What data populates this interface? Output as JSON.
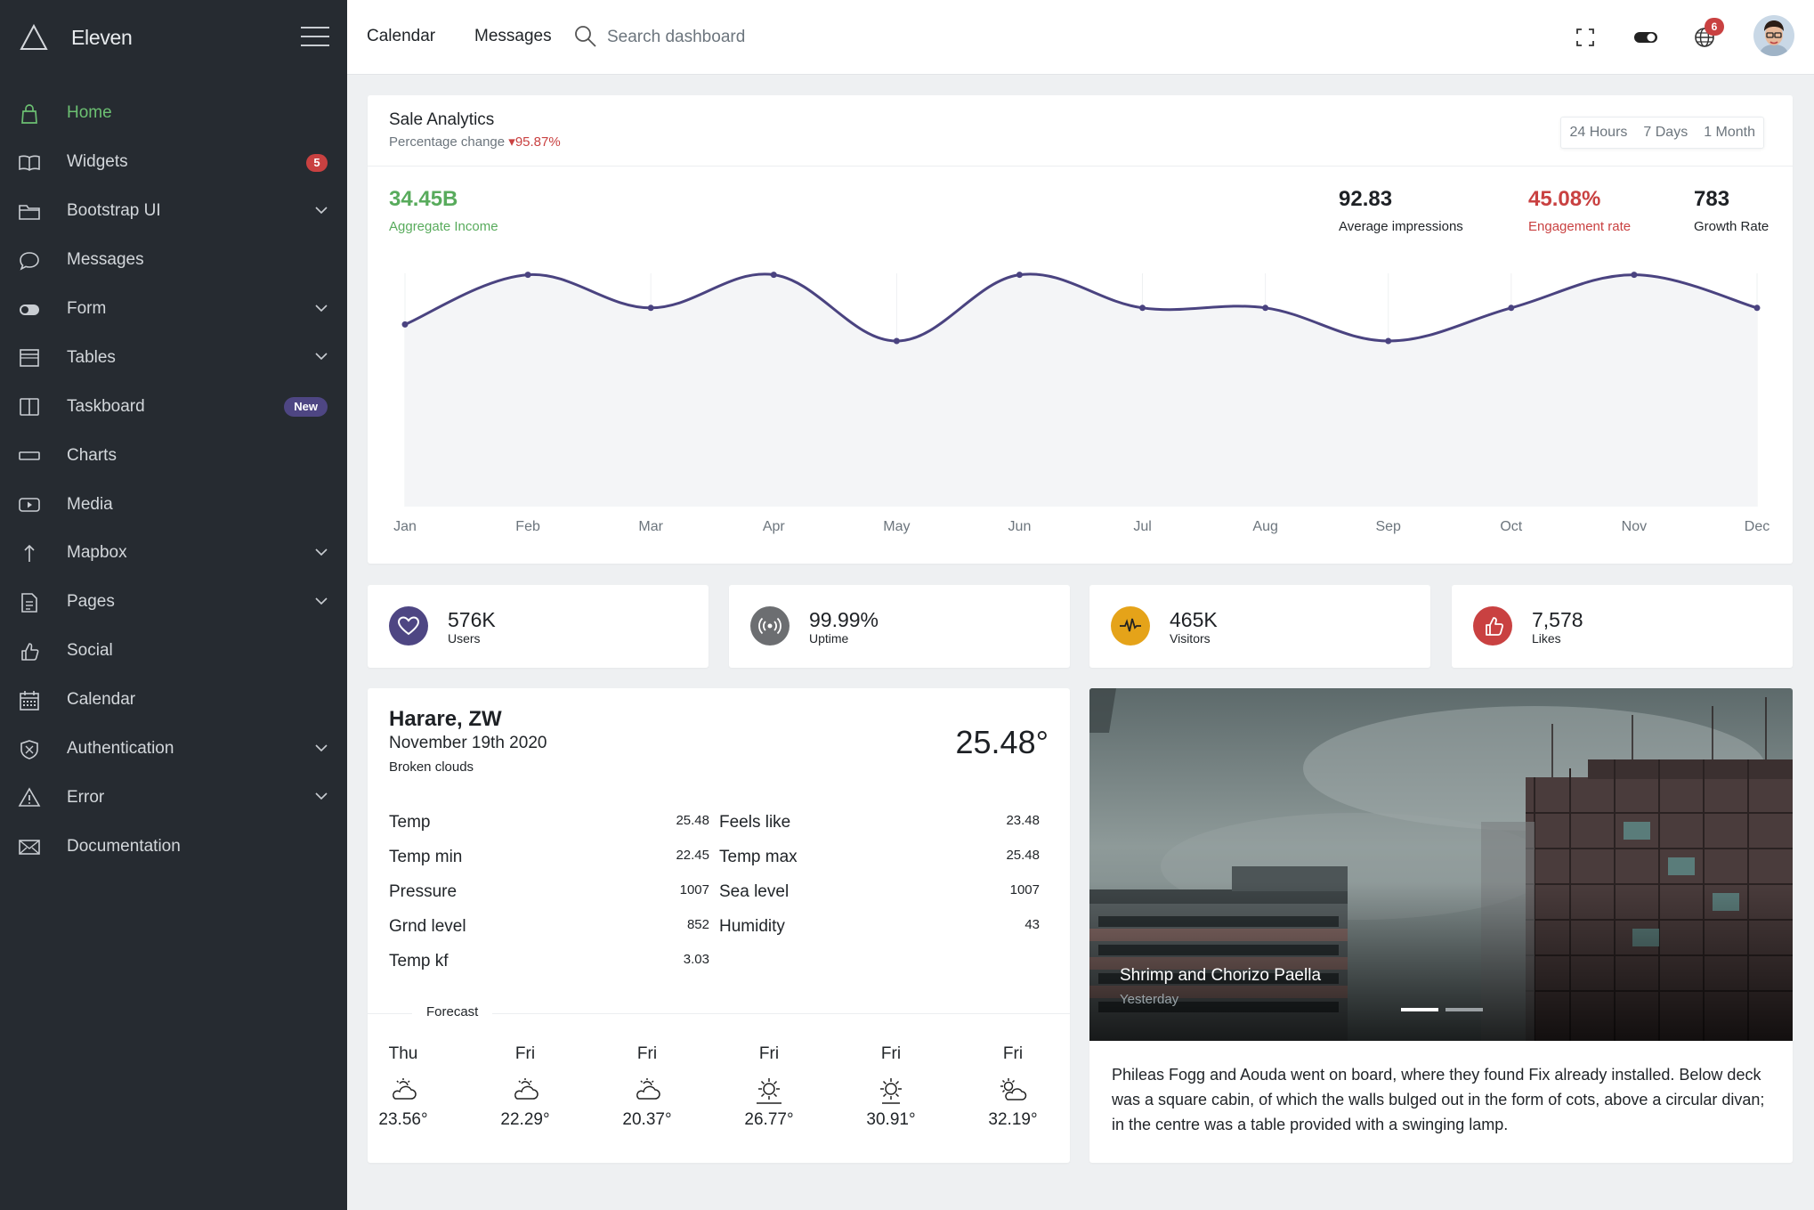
{
  "sidebar": {
    "brand": "Eleven",
    "items": [
      {
        "label": "Home",
        "icon": "bag-icon",
        "active": true
      },
      {
        "label": "Widgets",
        "icon": "book-icon",
        "badge": "5"
      },
      {
        "label": "Bootstrap UI",
        "icon": "folder-icon",
        "chevron": true
      },
      {
        "label": "Messages",
        "icon": "chat-icon"
      },
      {
        "label": "Form",
        "icon": "toggle-icon",
        "chevron": true
      },
      {
        "label": "Tables",
        "icon": "table-icon",
        "chevron": true
      },
      {
        "label": "Taskboard",
        "icon": "columns-icon",
        "badge_new": "New"
      },
      {
        "label": "Charts",
        "icon": "bar-icon"
      },
      {
        "label": "Media",
        "icon": "play-icon"
      },
      {
        "label": "Mapbox",
        "icon": "arrow-up-icon",
        "chevron": true
      },
      {
        "label": "Pages",
        "icon": "file-icon",
        "chevron": true
      },
      {
        "label": "Social",
        "icon": "thumb-icon"
      },
      {
        "label": "Calendar",
        "icon": "calendar-icon"
      },
      {
        "label": "Authentication",
        "icon": "shield-icon",
        "chevron": true
      },
      {
        "label": "Error",
        "icon": "warning-icon",
        "chevron": true
      },
      {
        "label": "Documentation",
        "icon": "mail-icon"
      }
    ]
  },
  "topbar": {
    "calendar_link": "Calendar",
    "messages_link": "Messages",
    "search_placeholder": "Search dashboard",
    "notification_count": "6"
  },
  "sale": {
    "title": "Sale Analytics",
    "subtitle_prefix": "Percentage change",
    "change": "95.87%",
    "ranges": [
      "24 Hours",
      "7 Days",
      "1 Month"
    ],
    "main_value": "34.45B",
    "main_label": "Aggregate Income",
    "kpis": [
      {
        "value": "92.83",
        "label": "Average impressions"
      },
      {
        "value": "45.08%",
        "label": "Engagement rate"
      },
      {
        "value": "783",
        "label": "Growth Rate"
      }
    ]
  },
  "chart_data": {
    "type": "area",
    "categories": [
      "Jan",
      "Feb",
      "Mar",
      "Apr",
      "May",
      "Jun",
      "Jul",
      "Aug",
      "Sep",
      "Oct",
      "Nov",
      "Dec"
    ],
    "values": [
      30,
      60,
      40,
      60,
      20,
      60,
      40,
      40,
      20,
      40,
      60,
      40
    ],
    "ylim": [
      -80,
      70
    ],
    "grid": true,
    "line_color": "#4a4380",
    "fill_color": "#f4f5f7"
  },
  "stats": [
    {
      "value": "576K",
      "label": "Users",
      "icon": "heart-icon",
      "color": "#4e4683"
    },
    {
      "value": "99.99%",
      "label": "Uptime",
      "icon": "broadcast-icon",
      "color": "#6c6e71"
    },
    {
      "value": "465K",
      "label": "Visitors",
      "icon": "pulse-icon",
      "color": "#e5a319"
    },
    {
      "value": "7,578",
      "label": "Likes",
      "icon": "thumb-up-icon",
      "color": "#c94141"
    }
  ],
  "weather": {
    "city": "Harare, ZW",
    "date": "November 19th 2020",
    "description": "Broken clouds",
    "temperature": "25.48°",
    "left": [
      {
        "label": "Temp",
        "value": "25.48"
      },
      {
        "label": "Temp min",
        "value": "22.45"
      },
      {
        "label": "Pressure",
        "value": "1007"
      },
      {
        "label": "Grnd level",
        "value": "852"
      },
      {
        "label": "Temp kf",
        "value": "3.03"
      }
    ],
    "right": [
      {
        "label": "Feels like",
        "value": "23.48"
      },
      {
        "label": "Temp max",
        "value": "25.48"
      },
      {
        "label": "Sea level",
        "value": "1007"
      },
      {
        "label": "Humidity",
        "value": "43"
      }
    ],
    "forecast_label": "Forecast",
    "forecast": [
      {
        "day": "Thu",
        "temp": "23.56°",
        "icon": "cloud-sun-icon"
      },
      {
        "day": "Fri",
        "temp": "22.29°",
        "icon": "cloud-sun-icon"
      },
      {
        "day": "Fri",
        "temp": "20.37°",
        "icon": "cloud-sun-icon"
      },
      {
        "day": "Fri",
        "temp": "26.77°",
        "icon": "sunrise-icon"
      },
      {
        "day": "Fri",
        "temp": "30.91°",
        "icon": "sun-icon"
      },
      {
        "day": "Fri",
        "temp": "32.19°",
        "icon": "partly-cloudy-icon"
      }
    ]
  },
  "news": {
    "caption_title": "Shrimp and Chorizo Paella",
    "caption_sub": "Yesterday",
    "text": "Phileas Fogg and Aouda went on board, where they found Fix already installed. Below deck was a square cabin, of which the walls bulged out in the form of cots, above a circular divan; in the centre was a table provided with a swinging lamp."
  }
}
